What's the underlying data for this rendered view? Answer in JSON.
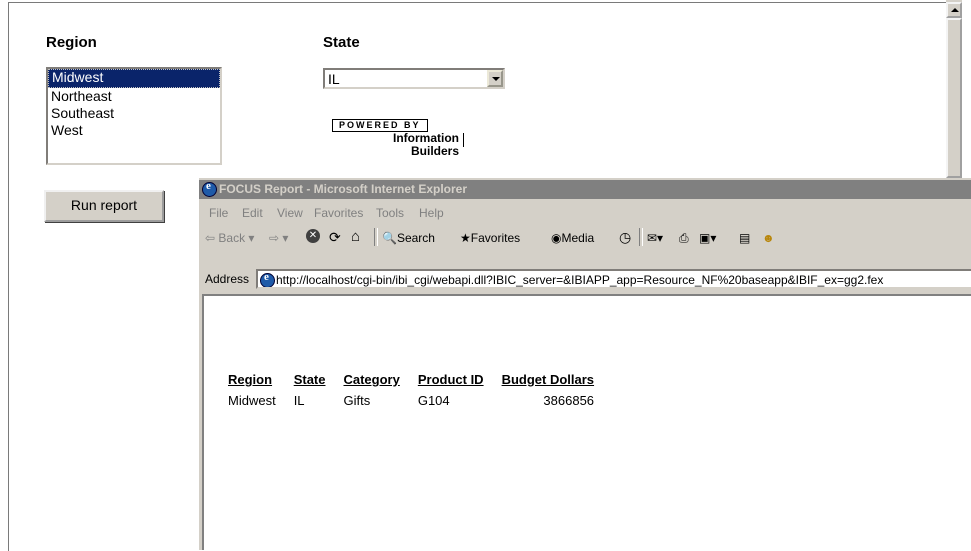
{
  "form": {
    "region_label": "Region",
    "state_label": "State",
    "regions": [
      "Midwest",
      "Northeast",
      "Southeast",
      "West"
    ],
    "selected_region_index": 0,
    "state_value": "IL",
    "run_button": "Run report",
    "logo": {
      "powered_by": "POWERED BY",
      "line1": "Information",
      "line2": "Builders"
    }
  },
  "browser": {
    "title": "FOCUS Report - Microsoft Internet Explorer",
    "menu": [
      "File",
      "Edit",
      "View",
      "Favorites",
      "Tools",
      "Help"
    ],
    "toolbar": {
      "back": "Back",
      "search": "Search",
      "favorites": "Favorites",
      "media": "Media"
    },
    "address_label": "Address",
    "address_url": "http://localhost/cgi-bin/ibi_cgi/webapi.dll?IBIC_server=&IBIAPP_app=Resource_NF%20baseapp&IBIF_ex=gg2.fex"
  },
  "report": {
    "headers": [
      "Region",
      "State",
      "Category",
      "Product ID",
      "Budget Dollars"
    ],
    "rows": [
      [
        "Midwest",
        "IL",
        "Gifts",
        "G104",
        "3866856"
      ]
    ]
  }
}
